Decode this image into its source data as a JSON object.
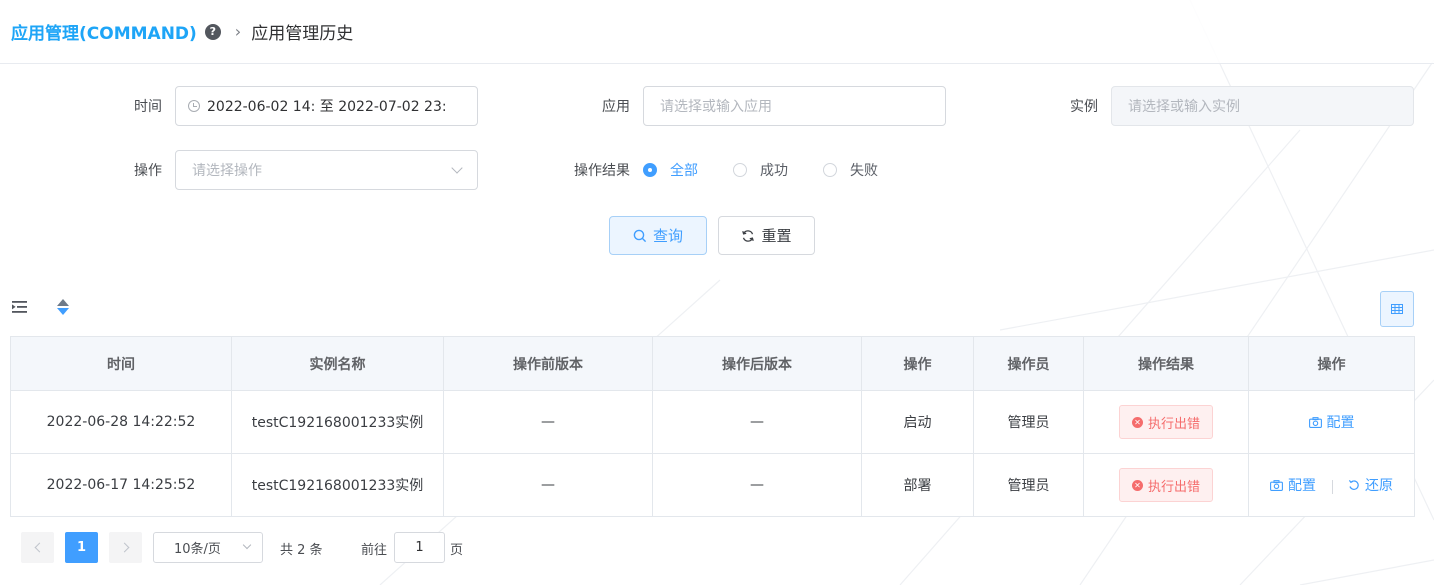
{
  "breadcrumb": {
    "root": "应用管理(COMMAND)",
    "current": "应用管理历史"
  },
  "icons": {
    "help": "question-circle-icon",
    "separator": "chevron-right-icon"
  },
  "colors": {
    "primary": "#409eff",
    "breadcrumb_root": "#1ea5f7",
    "error": "#f56c6c"
  },
  "form": {
    "time": {
      "label": "时间",
      "value": "2022-06-02 14: 至 2022-07-02 23:"
    },
    "app": {
      "label": "应用",
      "placeholder": "请选择或输入应用"
    },
    "instance": {
      "label": "实例",
      "placeholder": "请选择或输入实例"
    },
    "operation": {
      "label": "操作",
      "placeholder": "请选择操作"
    },
    "result": {
      "label": "操作结果",
      "selected": "全部",
      "options": [
        "全部",
        "成功",
        "失败"
      ]
    },
    "query_label": "查询",
    "reset_label": "重置"
  },
  "table": {
    "columns": [
      "时间",
      "实例名称",
      "操作前版本",
      "操作后版本",
      "操作",
      "操作员",
      "操作结果",
      "操作"
    ],
    "rows": [
      {
        "time": "2022-06-28 14:22:52",
        "instance": "testC192168001233实例",
        "before": "—",
        "after": "—",
        "operation": "启动",
        "operator": "管理员",
        "result": "执行出错",
        "actions": [
          "配置"
        ]
      },
      {
        "time": "2022-06-17 14:25:52",
        "instance": "testC192168001233实例",
        "before": "—",
        "after": "—",
        "operation": "部署",
        "operator": "管理员",
        "result": "执行出错",
        "actions": [
          "配置",
          "还原"
        ]
      }
    ]
  },
  "pagination": {
    "current_page": "1",
    "page_size": "10条/页",
    "total": "共 2 条",
    "goto_label": "前往",
    "goto_value": "1",
    "page_suffix": "页"
  }
}
